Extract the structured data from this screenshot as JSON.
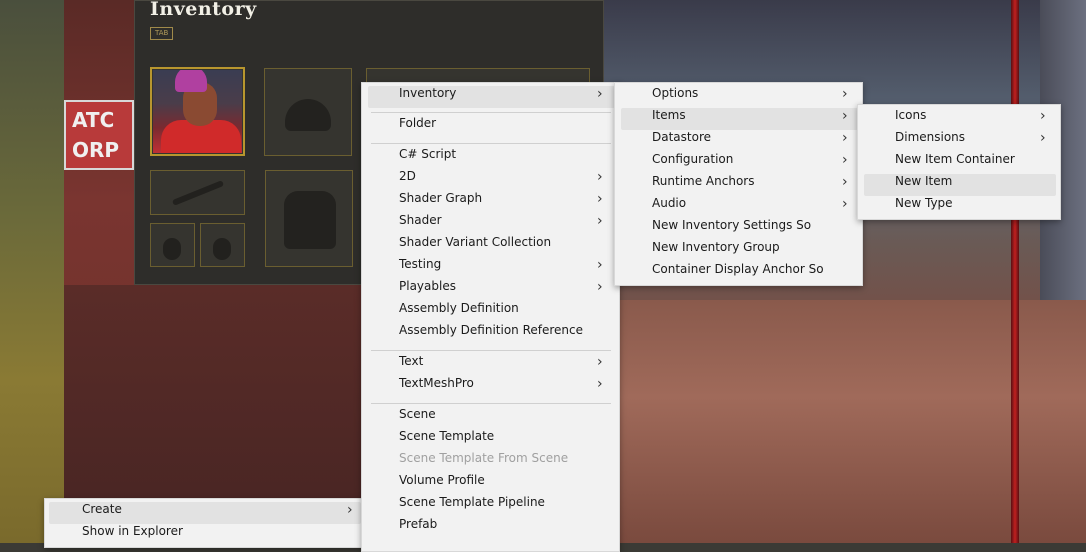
{
  "inventory_panel": {
    "title": "Inventory",
    "tab_hint": "TAB"
  },
  "background_sign": {
    "line1": "ATC",
    "line2": "ORP"
  },
  "context_menu_root": {
    "items": [
      {
        "label": "Create",
        "has_submenu": true,
        "highlighted": true
      },
      {
        "label": "Show in Explorer",
        "has_submenu": false
      }
    ]
  },
  "create_menu": {
    "items": [
      {
        "label": "Inventory",
        "has_submenu": true,
        "highlighted": true
      },
      {
        "label": "Folder"
      },
      {
        "label": "C# Script"
      },
      {
        "label": "2D",
        "has_submenu": true
      },
      {
        "label": "Shader Graph",
        "has_submenu": true
      },
      {
        "label": "Shader",
        "has_submenu": true
      },
      {
        "label": "Shader Variant Collection"
      },
      {
        "label": "Testing",
        "has_submenu": true
      },
      {
        "label": "Playables",
        "has_submenu": true
      },
      {
        "label": "Assembly Definition"
      },
      {
        "label": "Assembly Definition Reference"
      },
      {
        "label": "Text",
        "has_submenu": true
      },
      {
        "label": "TextMeshPro",
        "has_submenu": true
      },
      {
        "label": "Scene"
      },
      {
        "label": "Scene Template"
      },
      {
        "label": "Scene Template From Scene",
        "disabled": true
      },
      {
        "label": "Volume Profile"
      },
      {
        "label": "Scene Template Pipeline"
      },
      {
        "label": "Prefab"
      }
    ]
  },
  "inventory_menu": {
    "items": [
      {
        "label": "Options",
        "has_submenu": true
      },
      {
        "label": "Items",
        "has_submenu": true,
        "highlighted": true
      },
      {
        "label": "Datastore",
        "has_submenu": true
      },
      {
        "label": "Configuration",
        "has_submenu": true
      },
      {
        "label": "Runtime Anchors",
        "has_submenu": true
      },
      {
        "label": "Audio",
        "has_submenu": true
      },
      {
        "label": "New Inventory Settings So"
      },
      {
        "label": "New Inventory Group"
      },
      {
        "label": "Container Display Anchor So"
      }
    ]
  },
  "items_menu": {
    "items": [
      {
        "label": "Icons",
        "has_submenu": true
      },
      {
        "label": "Dimensions",
        "has_submenu": true
      },
      {
        "label": "New Item Container"
      },
      {
        "label": "New Item",
        "highlighted": true
      },
      {
        "label": "New Type"
      }
    ]
  },
  "submenu_arrow": "›",
  "colors": {
    "menu_bg": "#f2f2f2",
    "menu_highlight": "#e2e2e2",
    "disabled_text": "#a0a0a0",
    "inventory_slot_border": "#b8962e"
  }
}
